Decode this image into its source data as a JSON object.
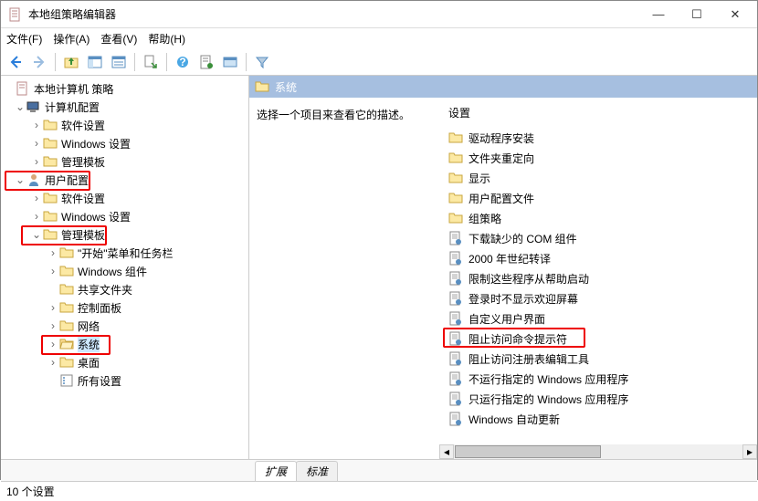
{
  "window": {
    "title": "本地组策略编辑器"
  },
  "menu": {
    "file": "文件(F)",
    "action": "操作(A)",
    "view": "查看(V)",
    "help": "帮助(H)"
  },
  "tree": {
    "root": "本地计算机 策略",
    "comp": "计算机配置",
    "comp_sw": "软件设置",
    "comp_win": "Windows 设置",
    "comp_adm": "管理模板",
    "user": "用户配置",
    "user_sw": "软件设置",
    "user_win": "Windows 设置",
    "user_adm": "管理模板",
    "adm_start": "\"开始\"菜单和任务栏",
    "adm_wincomp": "Windows 组件",
    "adm_share": "共享文件夹",
    "adm_ctrl": "控制面板",
    "adm_net": "网络",
    "adm_sys": "系统",
    "adm_desk": "桌面",
    "adm_all": "所有设置"
  },
  "breadcrumb": {
    "label": "系统"
  },
  "prompt": "选择一个项目来查看它的描述。",
  "settings": {
    "header": "设置",
    "items": [
      {
        "type": "folder",
        "label": "驱动程序安装"
      },
      {
        "type": "folder",
        "label": "文件夹重定向"
      },
      {
        "type": "folder",
        "label": "显示"
      },
      {
        "type": "folder",
        "label": "用户配置文件"
      },
      {
        "type": "folder",
        "label": "组策略"
      },
      {
        "type": "setting",
        "label": "下载缺少的 COM 组件"
      },
      {
        "type": "setting",
        "label": "2000 年世纪转译"
      },
      {
        "type": "setting",
        "label": "限制这些程序从帮助启动"
      },
      {
        "type": "setting",
        "label": "登录时不显示欢迎屏幕"
      },
      {
        "type": "setting",
        "label": "自定义用户界面"
      },
      {
        "type": "setting",
        "label": "阻止访问命令提示符",
        "hl": true
      },
      {
        "type": "setting",
        "label": "阻止访问注册表编辑工具"
      },
      {
        "type": "setting",
        "label": "不运行指定的 Windows 应用程序"
      },
      {
        "type": "setting",
        "label": "只运行指定的 Windows 应用程序"
      },
      {
        "type": "setting",
        "label": "Windows 自动更新"
      }
    ]
  },
  "tabs": {
    "ext": "扩展",
    "std": "标准"
  },
  "status": "10 个设置"
}
